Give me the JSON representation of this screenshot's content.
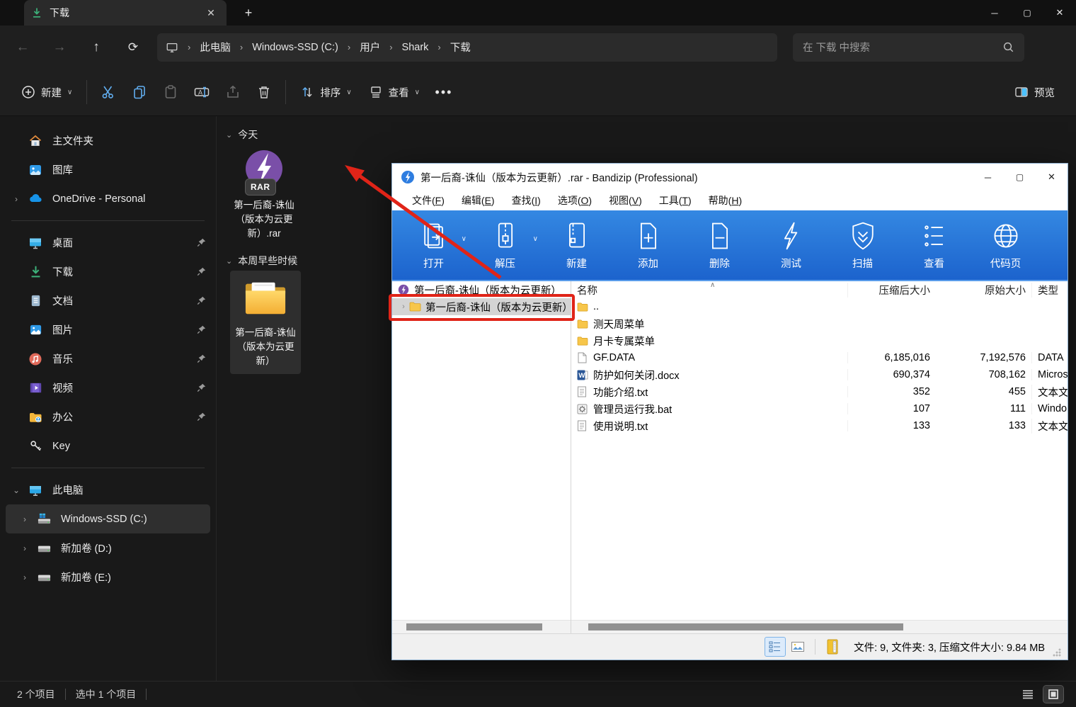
{
  "explorer": {
    "tab": {
      "title": "下载"
    },
    "nav": {
      "breadcrumb": [
        "此电脑",
        "Windows-SSD (C:)",
        "用户",
        "Shark",
        "下载"
      ],
      "search_placeholder": "在 下载 中搜索"
    },
    "commandbar": {
      "new_label": "新建",
      "sort_label": "排序",
      "view_label": "查看",
      "preview_label": "预览"
    },
    "sidebar": {
      "items": [
        {
          "label": "主文件夹"
        },
        {
          "label": "图库"
        },
        {
          "label": "OneDrive - Personal"
        },
        {
          "label": "桌面"
        },
        {
          "label": "下载"
        },
        {
          "label": "文档"
        },
        {
          "label": "图片"
        },
        {
          "label": "音乐"
        },
        {
          "label": "视频"
        },
        {
          "label": "办公"
        },
        {
          "label": "Key"
        },
        {
          "label": "此电脑"
        },
        {
          "label": "Windows-SSD (C:)"
        },
        {
          "label": "新加卷 (D:)"
        },
        {
          "label": "新加卷 (E:)"
        }
      ]
    },
    "content": {
      "groups": [
        {
          "header": "今天",
          "item_name": "第一后裔-诛仙（版本为云更新）.rar",
          "badge": "RAR"
        },
        {
          "header": "本周早些时候",
          "item_name": "第一后裔-诛仙（版本为云更新）"
        }
      ]
    },
    "statusbar": {
      "items_count": "2 个项目",
      "selected_count": "选中 1 个项目"
    }
  },
  "bandizip": {
    "title": "第一后裔-诛仙（版本为云更新）.rar - Bandizip (Professional)",
    "menu": [
      {
        "prefix": "文件(",
        "hotkey": "F",
        "suffix": ")"
      },
      {
        "prefix": "编辑(",
        "hotkey": "E",
        "suffix": ")"
      },
      {
        "prefix": "查找(",
        "hotkey": "I",
        "suffix": ")"
      },
      {
        "prefix": "选项(",
        "hotkey": "O",
        "suffix": ")"
      },
      {
        "prefix": "视图(",
        "hotkey": "V",
        "suffix": ")"
      },
      {
        "prefix": "工具(",
        "hotkey": "T",
        "suffix": ")"
      },
      {
        "prefix": "帮助(",
        "hotkey": "H",
        "suffix": ")"
      }
    ],
    "toolbar": [
      {
        "label": "打开"
      },
      {
        "label": "解压"
      },
      {
        "label": "新建"
      },
      {
        "label": "添加"
      },
      {
        "label": "删除"
      },
      {
        "label": "测试"
      },
      {
        "label": "扫描"
      },
      {
        "label": "查看"
      },
      {
        "label": "代码页"
      }
    ],
    "tree": {
      "root": "第一后裔-诛仙（版本为云更新）",
      "child": "第一后裔-诛仙（版本为云更新）"
    },
    "list": {
      "columns": {
        "name": "名称",
        "packed": "压缩后大小",
        "original": "原始大小",
        "type": "类型"
      },
      "rows": [
        {
          "name": "..",
          "packed": "",
          "original": "",
          "type": ""
        },
        {
          "name": "测天周菜单",
          "packed": "",
          "original": "",
          "type": ""
        },
        {
          "name": "月卡专属菜单",
          "packed": "",
          "original": "",
          "type": ""
        },
        {
          "name": "GF.DATA",
          "packed": "6,185,016",
          "original": "7,192,576",
          "type": "DATA"
        },
        {
          "name": "防护如何关闭.docx",
          "packed": "690,374",
          "original": "708,162",
          "type": "Micros"
        },
        {
          "name": "功能介绍.txt",
          "packed": "352",
          "original": "455",
          "type": "文本文"
        },
        {
          "name": "管理员运行我.bat",
          "packed": "107",
          "original": "111",
          "type": "Windo"
        },
        {
          "name": "使用说明.txt",
          "packed": "133",
          "original": "133",
          "type": "文本文"
        }
      ]
    },
    "statusbar": {
      "summary": "文件: 9, 文件夹: 3, 压缩文件大小: 9.84 MB"
    }
  },
  "colors": {
    "accent_blue": "#2f80dd",
    "annotation_red": "#e02418",
    "folder_yellow": "#f6b73c",
    "rar_purple": "#7a4fa8",
    "download_green": "#3db27a"
  }
}
